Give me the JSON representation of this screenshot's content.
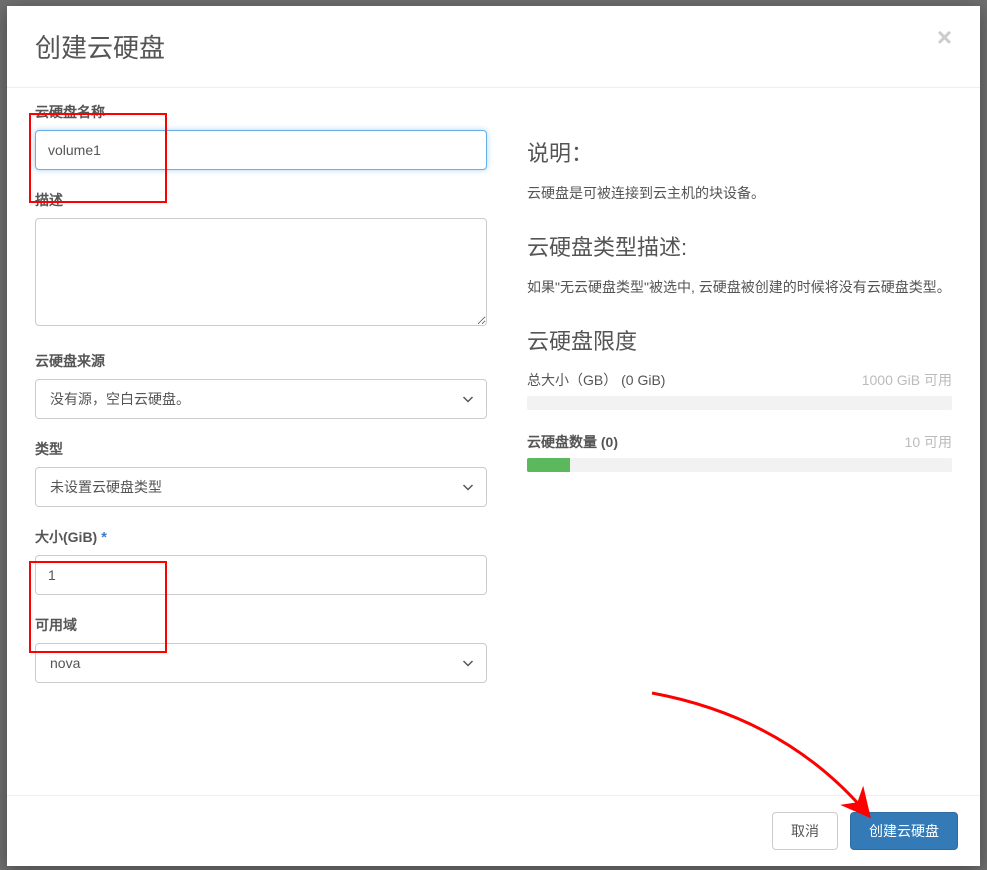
{
  "modal": {
    "title": "创建云硬盘",
    "close_icon": "×"
  },
  "form": {
    "name": {
      "label": "云硬盘名称",
      "value": "volume1"
    },
    "description": {
      "label": "描述",
      "value": ""
    },
    "source": {
      "label": "云硬盘来源",
      "selected": "没有源，空白云硬盘。"
    },
    "type": {
      "label": "类型",
      "selected": "未设置云硬盘类型"
    },
    "size": {
      "label": "大小(GiB)",
      "value": "1",
      "required_marker": "*"
    },
    "az": {
      "label": "可用域",
      "selected": "nova"
    }
  },
  "info": {
    "explain_h": "说明：",
    "explain_p": "云硬盘是可被连接到云主机的块设备。",
    "type_h": "云硬盘类型描述:",
    "type_p": "如果\"无云硬盘类型\"被选中, 云硬盘被创建的时候将没有云硬盘类型。",
    "limits_h": "云硬盘限度",
    "total_size": {
      "left": "总大小（GB） (0 GiB)",
      "right": "1000 GiB 可用",
      "pct": 0
    },
    "count": {
      "left": "云硬盘数量 (0)",
      "right": "10 可用",
      "pct": 10
    }
  },
  "footer": {
    "cancel": "取消",
    "submit": "创建云硬盘"
  }
}
